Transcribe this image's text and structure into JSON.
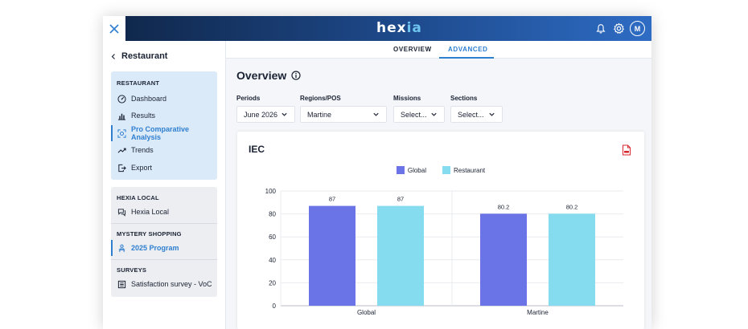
{
  "app": {
    "brand_main": "hex",
    "brand_accent": "ia",
    "avatar_initial": "M"
  },
  "colors": {
    "accent": "#2f7fd0",
    "topbar_start": "#0f2547",
    "topbar_end": "#2e6cc4",
    "global": "#6b74e6",
    "restaurant": "#86dcef"
  },
  "sidebar": {
    "back_label": "Restaurant",
    "section_restaurant": "RESTAURANT",
    "items": [
      {
        "label": "Dashboard",
        "icon": "dashboard-icon"
      },
      {
        "label": "Results",
        "icon": "bar-chart-icon"
      },
      {
        "label": "Pro Comparative Analysis",
        "icon": "comparison-icon",
        "selected": true
      },
      {
        "label": "Trends",
        "icon": "trend-icon"
      },
      {
        "label": "Export",
        "icon": "export-icon"
      }
    ],
    "section_local": "HEXIA LOCAL",
    "local_item": "Hexia Local",
    "section_mystery": "MYSTERY SHOPPING",
    "mystery_item": "2025 Program",
    "section_surveys": "SURVEYS",
    "surveys_item": "Satisfaction survey - VoC"
  },
  "tabs": [
    {
      "label": "OVERVIEW"
    },
    {
      "label": "ADVANCED",
      "active": true
    }
  ],
  "main": {
    "title": "Overview",
    "filters": [
      {
        "label": "Periods",
        "value": "June 2026"
      },
      {
        "label": "Regions/POS",
        "value": "Martine"
      },
      {
        "label": "Missions",
        "value": "Select..."
      },
      {
        "label": "Sections",
        "value": "Select..."
      }
    ]
  },
  "card": {
    "title": "IEC"
  },
  "chart_data": {
    "type": "bar",
    "title": "IEC",
    "categories": [
      "Global",
      "Martine"
    ],
    "series": [
      {
        "name": "Global",
        "values": [
          87,
          80.2
        ],
        "labels": [
          "87",
          "80.2"
        ]
      },
      {
        "name": "Restaurant",
        "values": [
          87,
          80.2
        ],
        "labels": [
          "87",
          "80.2"
        ]
      }
    ],
    "ylim": [
      0,
      100
    ],
    "yticks": [
      "0",
      "20",
      "40",
      "60",
      "80",
      "100"
    ],
    "grid": true,
    "legend": "top-center"
  }
}
